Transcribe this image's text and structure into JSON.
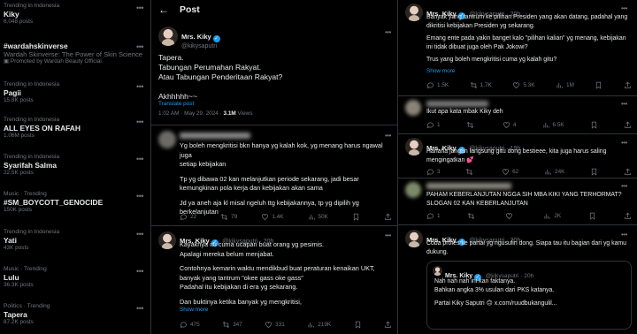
{
  "trends": [
    {
      "meta": "Trending in Indonesia",
      "name": "Kiky",
      "count": "6,048 posts"
    },
    {
      "name": "#wardahskinverse",
      "desc": "Wardah Skinverse: The Power of Skin Science",
      "promo": "Promoted by Wardah Beauty Official"
    },
    {
      "meta": "Trending in Indonesia",
      "name": "Pagii",
      "count": "15.8K posts"
    },
    {
      "meta": "Trending in Indonesia",
      "name": "ALL EYES ON RAFAH",
      "count": "1.06M posts"
    },
    {
      "meta": "Trending in Indonesia",
      "name": "Syarifah Salma",
      "count": "22.5K posts"
    },
    {
      "meta": "Music · Trending",
      "name": "#SM_BOYCOTT_GENOCIDE",
      "count": "150K posts"
    },
    {
      "meta": "Trending in Indonesia",
      "name": "Yati",
      "count": "43K posts"
    },
    {
      "meta": "Music · Trending",
      "name": "Lulu",
      "count": "36.3K posts"
    },
    {
      "meta": "Politics · Trending",
      "name": "Tapera",
      "count": "87.2K posts"
    }
  ],
  "post": {
    "header_title": "Post",
    "author_name": "Mrs. Kiky",
    "author_handle": "@kikysaputri",
    "text_lines": [
      "Tapera.",
      "Tabungan Perumahan Rakyat.",
      "Atau Tabungan Penderitaan Rakyat?",
      "",
      "Akhhhhh~~"
    ],
    "translate": "Translate post",
    "time": "1:02 AM · May 29, 2024 · ",
    "views_count": "3.1M",
    "views_label": " Views"
  },
  "reply1": {
    "lines": [
      "Yg boleh mengkritisi bkn hanya yg kalah kok, yg menang harus ngawal juga",
      "setiap kebijakan",
      "",
      "Tp yg dibawa 02 kan melanjutkan periode sekarang, jadi besar",
      "kemungkinan pola kerja dan kebijakan akan sama",
      "",
      "Jd ya aneh aja kl misal ngeluh ttg kebijakannya, tp yg dipilih yg",
      "berkelanjutan"
    ],
    "actions": [
      "22",
      "79",
      "1.4K",
      "50K"
    ]
  },
  "reply2": {
    "author_name": "Mrs. Kiky",
    "handle_time": "@kikysaputri · 20h",
    "lines": [
      "Kayaknya itu cuma ucapan buat orang yg pesimis.",
      "Apalagi mereka belum menjabat.",
      "",
      "Contohnya kemarin waktu mendikbud buat peraturan kenaikan UKT,",
      "banyak yang tantrum \"okee gass oke gass\"",
      "Padahal itu kebijakan di era yg sekarang.",
      "",
      "Dan buktinya ketika banyak yg mengkritisi,"
    ],
    "show_more": "Show more",
    "actions": [
      "475",
      "347",
      "331",
      "219K"
    ]
  },
  "right_top": {
    "author_name": "Mrs. Kiky",
    "handle_time": "@kikysaputri · 20h",
    "lines": [
      "Banyak yang tantrum ke pilihan Presiden yang akan datang, padahal yang",
      "dikritisi kebijakan Presiden yg sekarang.",
      "",
      "Emang ente pada yakin banget kalo \"pilihan kalian\" yg menang, kebijakan",
      "ini tidak dibuat juga oleh Pak Jokowi?",
      "",
      "Trus yang boleh mengkritisi cuma yg kalah gitu?"
    ],
    "show_more": "Show more",
    "actions": [
      "1.5K",
      "1.7K",
      "5.3K",
      "1M"
    ]
  },
  "right_r1": {
    "text": "Ikut apa kata mbak Kiky deh",
    "actions": [
      "1",
      "",
      "4",
      "6.5K"
    ]
  },
  "right_r2": {
    "author_name": "Mrs. Kiky",
    "handle_time": "@kikysaputri · 19h",
    "lines": [
      "Hahaha jangan langsung gitu dong bestieee, kita juga harus saling",
      "mengingatkan 💕"
    ],
    "actions": [
      "3",
      "",
      "62",
      "24K"
    ]
  },
  "right_r3": {
    "lines": [
      "PAHAM KEBERLANJUTAN NGGA SIH MBA KIKI YANG TERHORMAT?",
      "SLOGAN 02 KAN KEBERLANJUTAN"
    ],
    "actions": [
      "1",
      "",
      "",
      "2K"
    ]
  },
  "right_r4": {
    "author_name": "Mrs. Kiky",
    "handle_time": "@kikysaputri · 20h",
    "lines": [
      "Coba protes ke partai yg ngusulin dong. Siapa tau itu bagian dari yg kamu",
      "dukung."
    ],
    "quote": {
      "author_name": "Mrs. Kiky",
      "handle_time": "@kikysaputri · 20h",
      "lines": [
        "Nah nah nah ini kan faktanya.",
        "Bahkan angka 3% usulan dari PKS katanya.",
        "",
        "Partai Kiky Saputri 🙃 x.com/ruudbukangulil..."
      ]
    }
  },
  "colors": {
    "background": "#000000",
    "text": "#e7e9ea",
    "muted": "#71767b",
    "accent": "#1d9bf0",
    "border": "#2f3336"
  }
}
